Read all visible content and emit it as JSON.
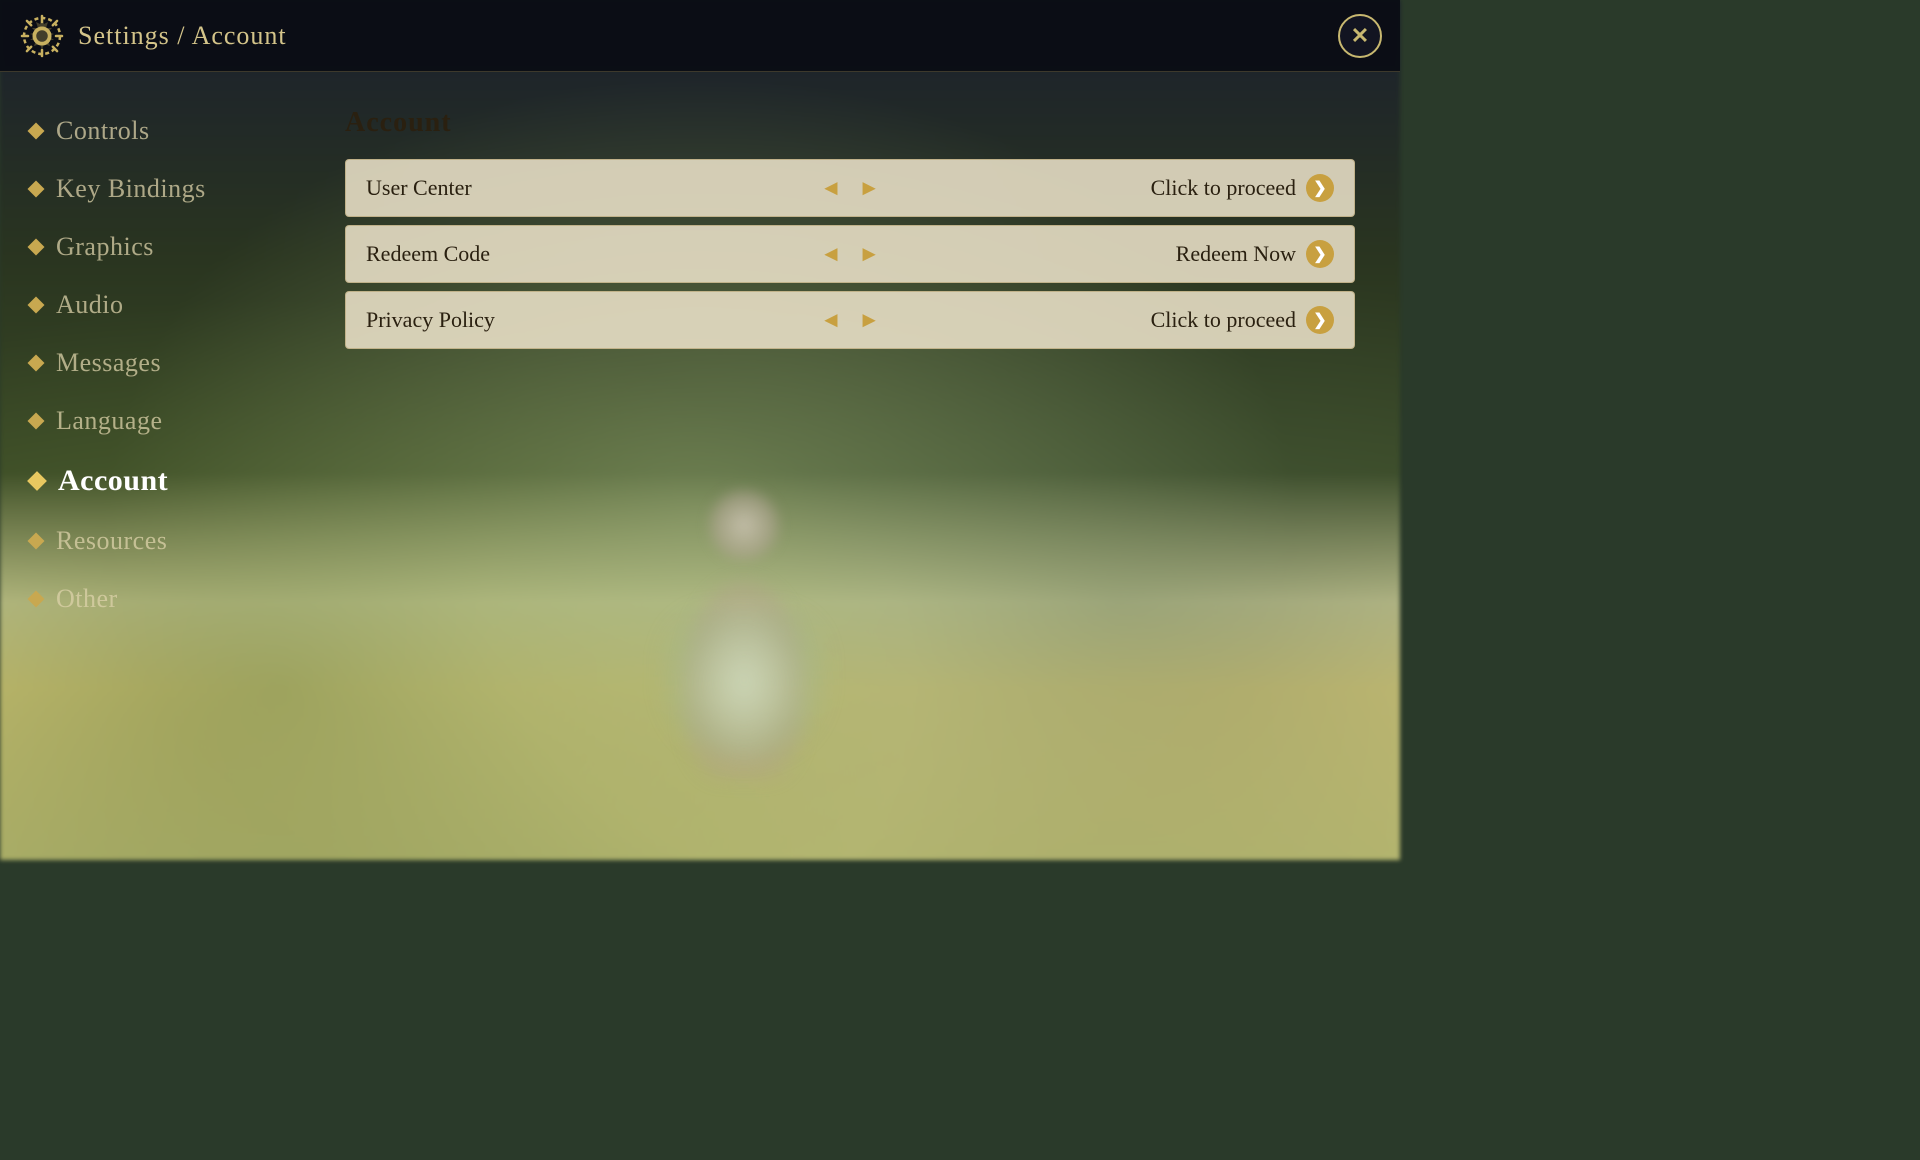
{
  "header": {
    "title": "Settings / Account",
    "close_label": "✕"
  },
  "sidebar": {
    "items": [
      {
        "id": "controls",
        "label": "Controls",
        "active": false
      },
      {
        "id": "key-bindings",
        "label": "Key Bindings",
        "active": false
      },
      {
        "id": "graphics",
        "label": "Graphics",
        "active": false
      },
      {
        "id": "audio",
        "label": "Audio",
        "active": false
      },
      {
        "id": "messages",
        "label": "Messages",
        "active": false
      },
      {
        "id": "language",
        "label": "Language",
        "active": false
      },
      {
        "id": "account",
        "label": "Account",
        "active": true
      },
      {
        "id": "resources",
        "label": "Resources",
        "active": false
      },
      {
        "id": "other",
        "label": "Other",
        "active": false
      }
    ]
  },
  "main": {
    "section_title": "Account",
    "rows": [
      {
        "id": "user-center",
        "label": "User Center",
        "action": "Click to proceed"
      },
      {
        "id": "redeem-code",
        "label": "Redeem Code",
        "action": "Redeem Now"
      },
      {
        "id": "privacy-policy",
        "label": "Privacy Policy",
        "action": "Click to proceed"
      }
    ]
  },
  "icons": {
    "gear": "⚙",
    "diamond": "◆",
    "arrow_right": "❯",
    "double_arrow": "«»"
  }
}
